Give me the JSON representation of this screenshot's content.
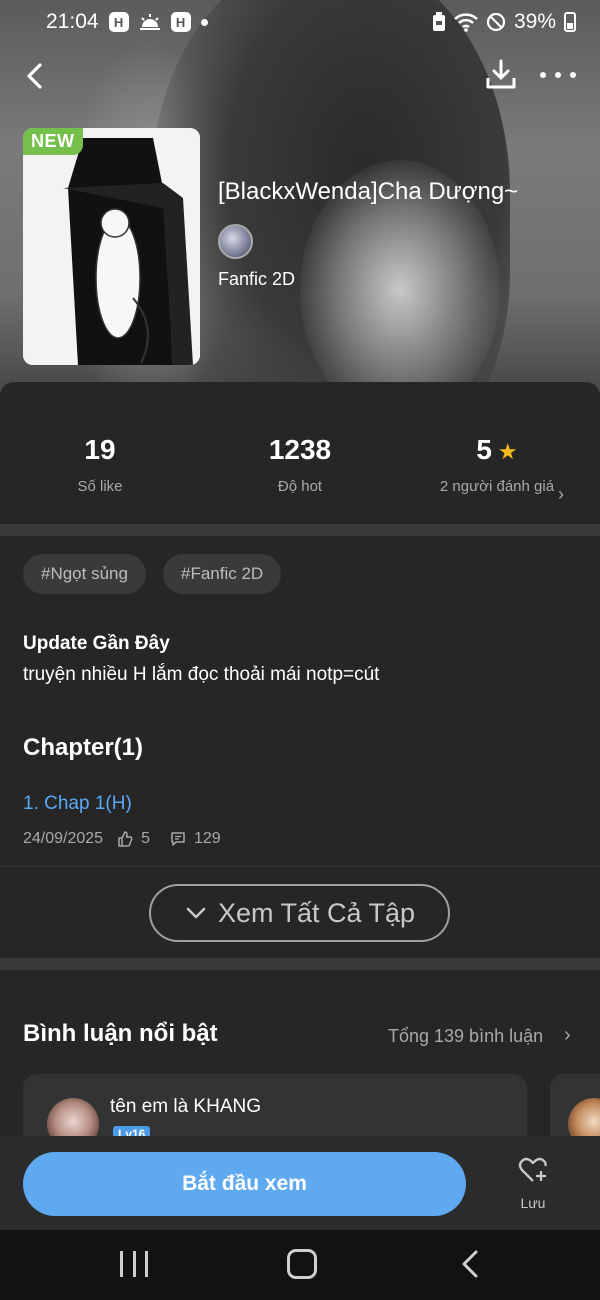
{
  "status_bar": {
    "time": "21:04",
    "battery": "39%",
    "badge_a": "H",
    "badge_b": "H"
  },
  "comic": {
    "new_tag": "NEW",
    "title": "[BlackxWenda]Cha Dượng~",
    "genre": "Fanfic 2D"
  },
  "stats": [
    {
      "value": "19",
      "label": "Số like"
    },
    {
      "value": "1238",
      "label": "Độ hot"
    },
    {
      "value": "5",
      "label": "2 người đánh giá"
    }
  ],
  "tags": [
    "#Ngọt sủng",
    "#Fanfic 2D"
  ],
  "update": {
    "title": "Update Gần Đây",
    "text": "truyện nhiều H lắm đọc thoải mái notp=cút"
  },
  "chapters": {
    "title": "Chapter(1)",
    "items": [
      {
        "label": "1. Chap 1(H)",
        "date": "24/09/2025",
        "likes": "5",
        "comments": "129"
      }
    ],
    "see_all": "Xem Tất Cả Tập"
  },
  "comments": {
    "title": "Bình luận nổi bật",
    "total": "Tổng 139 bình luận",
    "items": [
      {
        "name": "tên em là KHANG",
        "level": "Lv16"
      }
    ]
  },
  "actions": {
    "start": "Bắt đầu xem",
    "save": "Lưu"
  },
  "colors": {
    "accent_blue": "#5fa9f1",
    "link_blue": "#5aa8f5",
    "new_green": "#74c04a",
    "star_gold": "#f5b91d",
    "background": "#262626"
  }
}
